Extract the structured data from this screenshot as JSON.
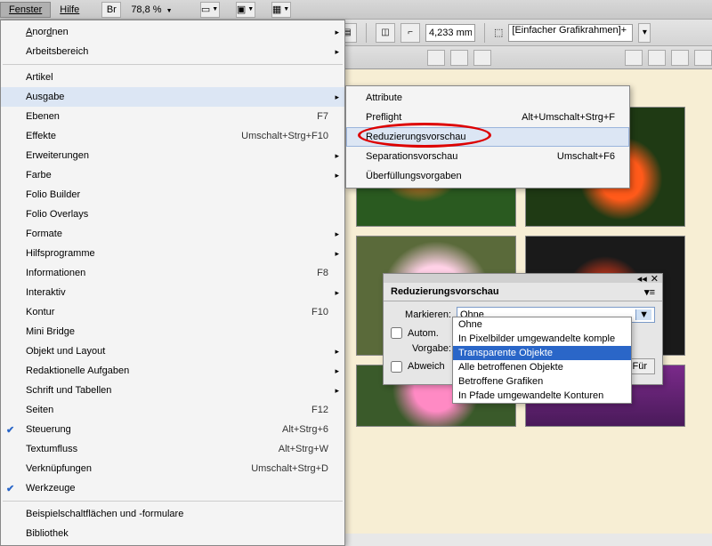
{
  "menubar": {
    "fenster": "Fenster",
    "hilfe": "Hilfe",
    "br": "Br",
    "zoom": "78,8 %"
  },
  "toolbar": {
    "mm": "4,233 mm",
    "preset_icon": "⬚",
    "preset": "[Einfacher Grafikrahmen]+"
  },
  "menu": {
    "anordnen": "Anordnen",
    "arbeitsbereich": "Arbeitsbereich",
    "artikel": "Artikel",
    "ausgabe": "Ausgabe",
    "ebenen": "Ebenen",
    "ebenen_sc": "F7",
    "effekte": "Effekte",
    "effekte_sc": "Umschalt+Strg+F10",
    "erweiterungen": "Erweiterungen",
    "farbe": "Farbe",
    "folio_builder": "Folio Builder",
    "folio_overlays": "Folio Overlays",
    "formate": "Formate",
    "hilfsprogramme": "Hilfsprogramme",
    "informationen": "Informationen",
    "informationen_sc": "F8",
    "interaktiv": "Interaktiv",
    "kontur": "Kontur",
    "kontur_sc": "F10",
    "mini_bridge": "Mini Bridge",
    "objekt_layout": "Objekt und Layout",
    "redaktionelle": "Redaktionelle Aufgaben",
    "schrift_tabellen": "Schrift und Tabellen",
    "seiten": "Seiten",
    "seiten_sc": "F12",
    "steuerung": "Steuerung",
    "steuerung_sc": "Alt+Strg+6",
    "textumfluss": "Textumfluss",
    "textumfluss_sc": "Alt+Strg+W",
    "verknuepfungen": "Verknüpfungen",
    "verknuepfungen_sc": "Umschalt+Strg+D",
    "werkzeuge": "Werkzeuge",
    "beispiel": "Beispielschaltflächen und -formulare",
    "bibliothek": "Bibliothek"
  },
  "submenu": {
    "attribute": "Attribute",
    "preflight": "Preflight",
    "preflight_sc": "Alt+Umschalt+Strg+F",
    "reduzierung": "Reduzierungsvorschau",
    "separation": "Separationsvorschau",
    "separation_sc": "Umschalt+F6",
    "ueberfuellung": "Überfüllungsvorgaben"
  },
  "panel": {
    "title": "Reduzierungsvorschau",
    "markieren": "Markieren:",
    "markieren_val": "Ohne",
    "autom": "Autom.",
    "vorgabe": "Vorgabe:",
    "abweich": "Abweich",
    "fuer": "Für",
    "options": {
      "o0": "Ohne",
      "o1": "In Pixelbilder umgewandelte komple",
      "o2": "Transparente Objekte",
      "o3": "Alle betroffenen Objekte",
      "o4": "Betroffene Grafiken",
      "o5": "In Pfade umgewandelte Konturen"
    }
  }
}
